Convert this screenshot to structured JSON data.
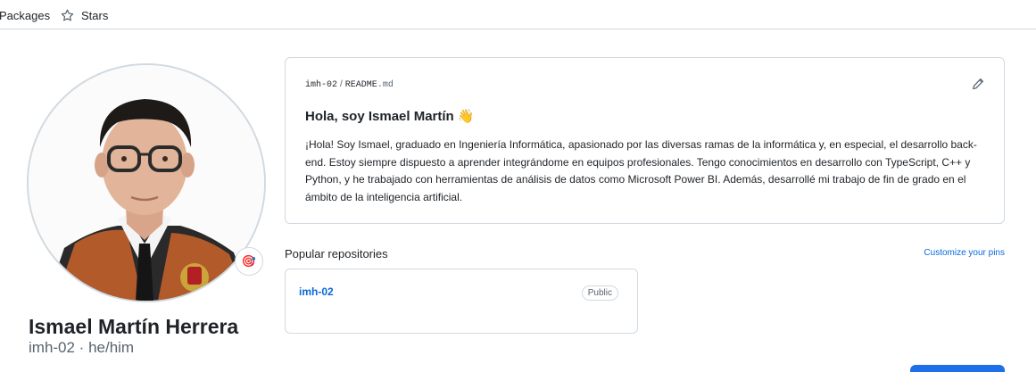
{
  "nav": {
    "packages_label": "Packages",
    "stars_label": "Stars",
    "stars_icon": "star-icon"
  },
  "profile": {
    "name": "Ismael Martín Herrera",
    "login_pronouns": "imh-02 · he/him",
    "status_icon": "target-emoji-icon"
  },
  "readme": {
    "owner": "imh-02",
    "separator": "/",
    "file": "README",
    "ext": ".md",
    "title": "Hola, soy Ismael Martín 👋",
    "body": "¡Hola! Soy Ismael, graduado en Ingeniería Informática, apasionado por las diversas ramas de la informática y, en especial, el desarrollo back-end. Estoy siempre dispuesto a aprender integrándome en equipos profesionales. Tengo conocimientos en desarrollo con TypeScript, C++ y Python, y he trabajado con herramientas de análisis de datos como Microsoft Power BI. Además, desarrollé mi trabajo de fin de grado en el ámbito de la inteligencia artificial.",
    "edit_icon": "pencil-icon"
  },
  "popular": {
    "heading": "Popular repositories",
    "customize_label": "Customize your pins",
    "repos": [
      {
        "name": "imh-02",
        "visibility": "Public"
      }
    ]
  },
  "colors": {
    "link": "#0969da",
    "border": "#d1d9e0",
    "muted": "#59636e",
    "text": "#1f2328"
  }
}
